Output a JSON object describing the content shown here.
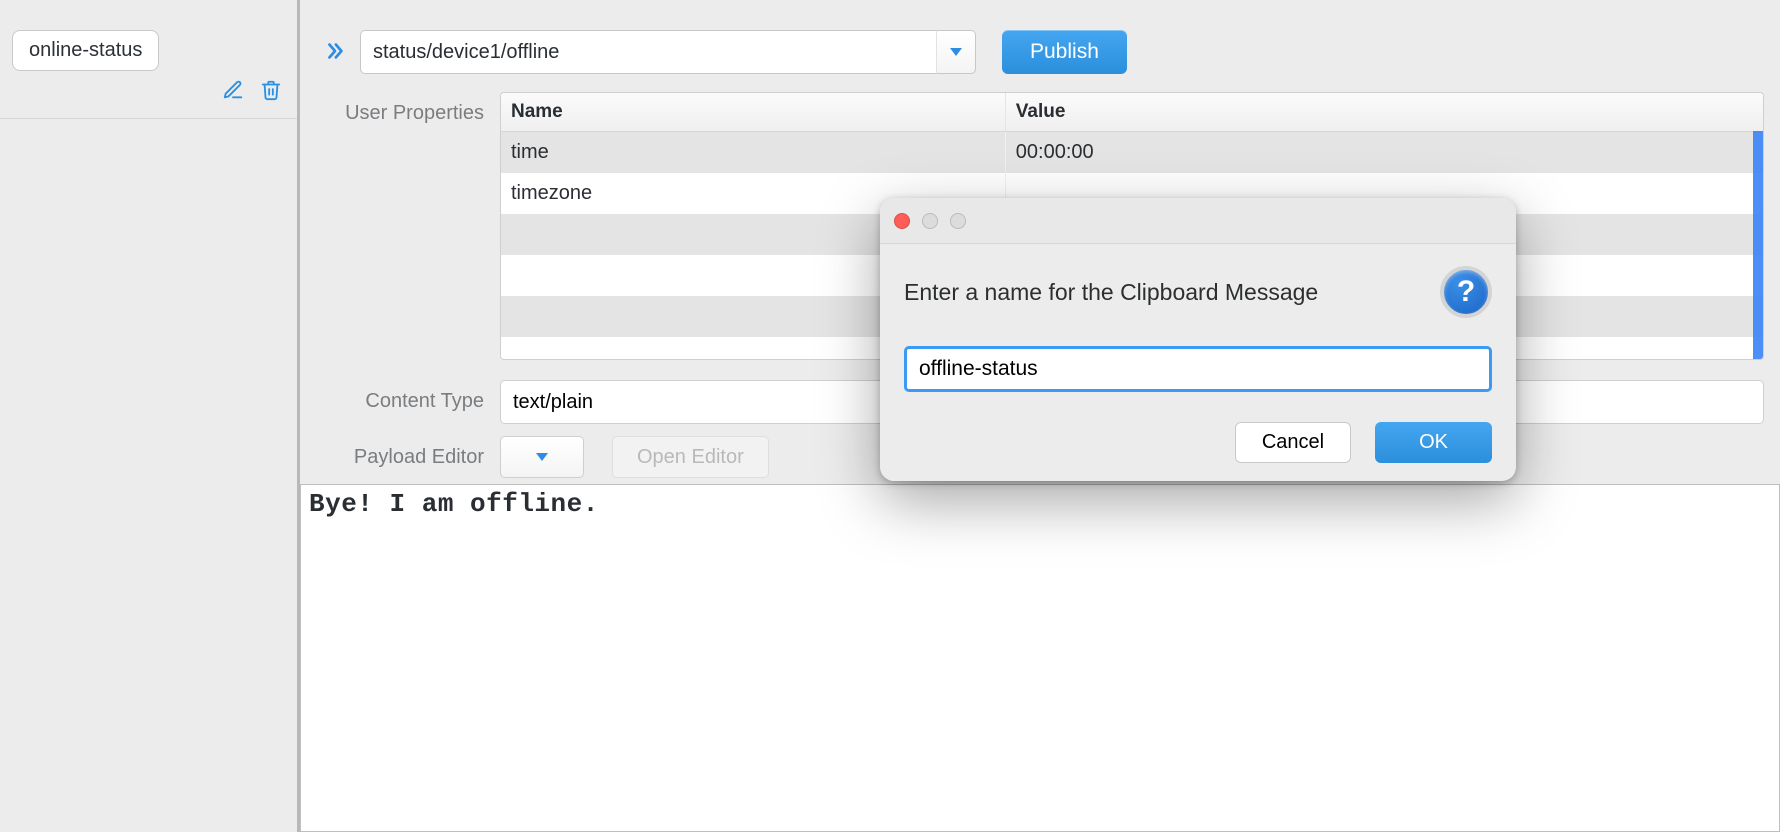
{
  "sidebar": {
    "items": [
      {
        "label": "online-status"
      }
    ]
  },
  "toolbar": {
    "topic_value": "status/device1/offline",
    "publish_label": "Publish"
  },
  "labels": {
    "user_properties": "User Properties",
    "content_type": "Content Type",
    "payload_editor": "Payload Editor",
    "open_editor": "Open Editor"
  },
  "properties": {
    "headers": {
      "name": "Name",
      "value": "Value"
    },
    "rows": [
      {
        "name": "time",
        "value": "00:00:00"
      },
      {
        "name": "timezone",
        "value": ""
      }
    ]
  },
  "content_type_value": "text/plain",
  "payload_text": "Bye! I am offline.",
  "modal": {
    "message": "Enter a name for the Clipboard Message",
    "input_value": "offline-status",
    "cancel_label": "Cancel",
    "ok_label": "OK"
  }
}
